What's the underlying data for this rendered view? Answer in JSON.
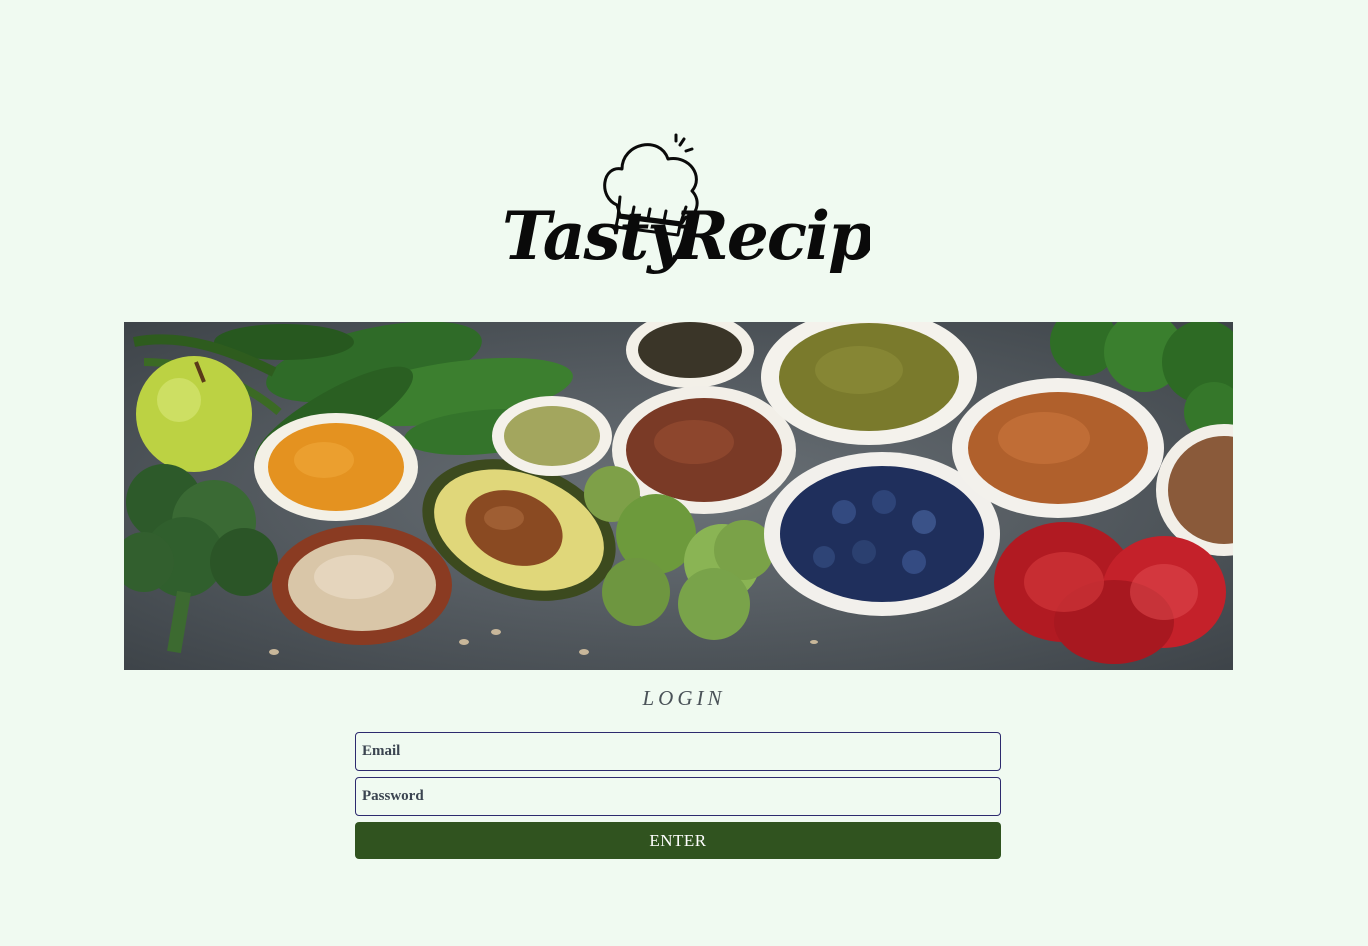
{
  "brand": {
    "logo_text_1": "Tasty",
    "logo_text_2": "Recipes",
    "logo_icon": "chef-hat-icon"
  },
  "hero": {
    "image": "healthy-food-bowls-banner"
  },
  "login": {
    "title": "LOGIN",
    "email_placeholder": "Email",
    "password_placeholder": "Password",
    "submit_label": "ENTER"
  },
  "colors": {
    "background": "#f0faf1",
    "button": "#30531f",
    "field_border": "#2d2a6e"
  }
}
